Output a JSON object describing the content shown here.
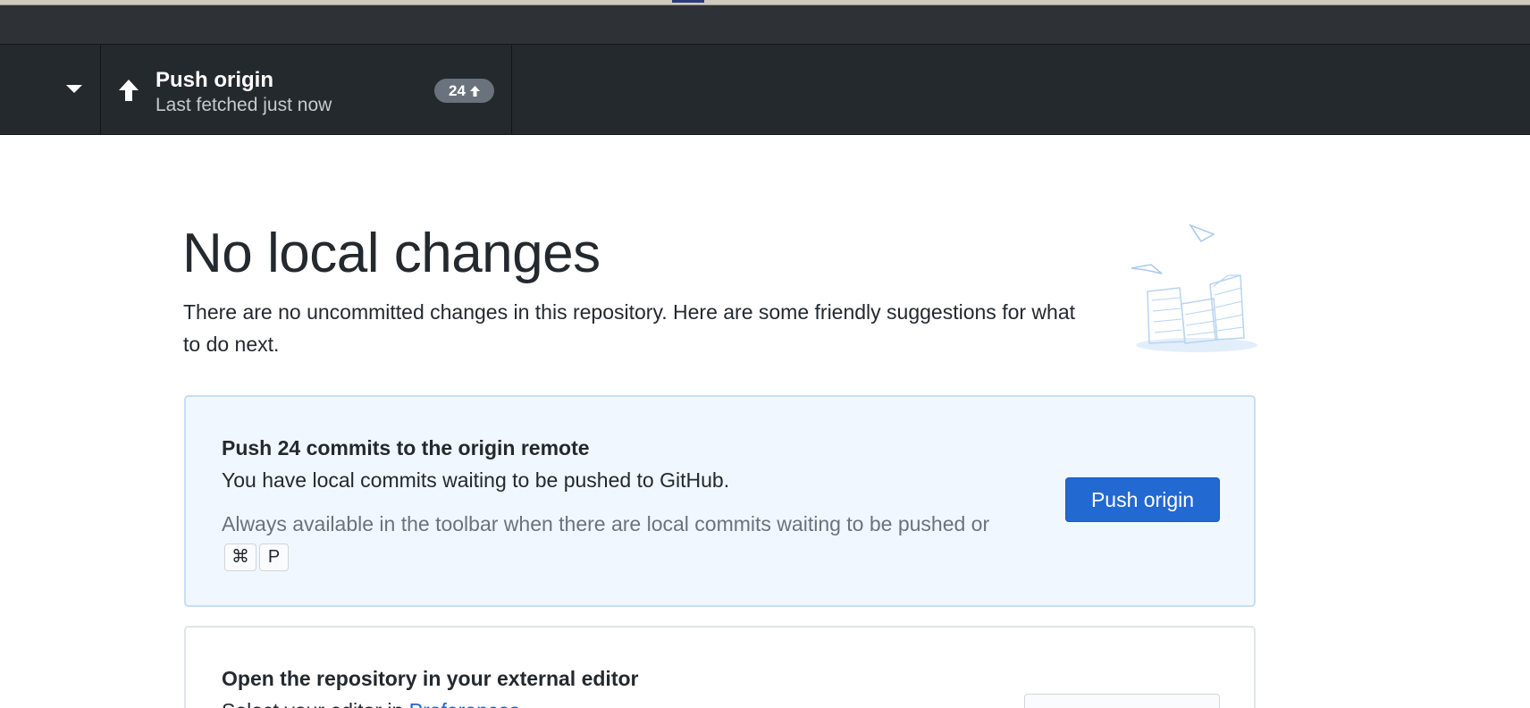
{
  "toolbar": {
    "push": {
      "title": "Push origin",
      "subtitle": "Last fetched just now",
      "badge_count": "24"
    }
  },
  "main": {
    "heading": "No local changes",
    "intro": "There are no uncommitted changes in this repository. Here are some friendly suggestions for what to do next.",
    "push_card": {
      "title": "Push 24 commits to the origin remote",
      "description": "You have local commits waiting to be pushed to GitHub.",
      "hint": "Always available in the toolbar when there are local commits waiting to be pushed or",
      "shortcut_keys": [
        "⌘",
        "P"
      ],
      "button_label": "Push origin"
    },
    "editor_card": {
      "title": "Open the repository in your external editor",
      "description_prefix": "Select your editor in ",
      "description_link": "Preferences"
    }
  },
  "colors": {
    "toolbar_bg": "#24292e",
    "primary_button": "#2269d2",
    "card_accent_bg": "#f1f7fe",
    "link": "#2166d3",
    "muted_text": "#6a737d"
  },
  "icons": {
    "dropdown": "triangle-down-icon",
    "push": "arrow-up-icon",
    "badge": "arrow-up-icon",
    "illustration": "paper-stack-illustration"
  }
}
